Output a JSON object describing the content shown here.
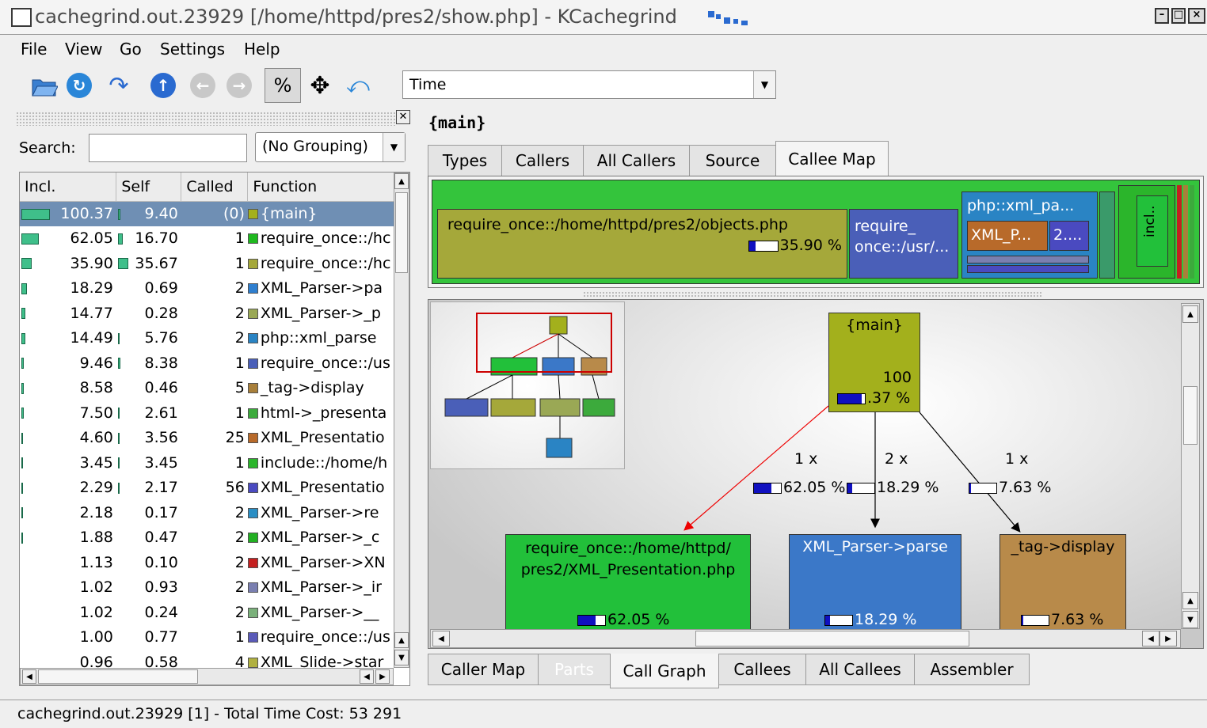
{
  "window": {
    "title": "cachegrind.out.23929 [/home/httpd/pres2/show.php] - KCachegrind"
  },
  "menu": [
    "File",
    "View",
    "Go",
    "Settings",
    "Help"
  ],
  "toolbar": {
    "percent_label": "%",
    "event_type": "Time"
  },
  "left": {
    "search_label": "Search:",
    "search_value": "",
    "grouping": "(No Grouping)",
    "columns": [
      "Incl.",
      "Self",
      "Called",
      "Function"
    ],
    "rows": [
      {
        "incl": "100.37",
        "self": "9.40",
        "called": "(0)",
        "func": "{main}",
        "color": "#a3b01c"
      },
      {
        "incl": "62.05",
        "self": "16.70",
        "called": "1",
        "func": "require_once::/hc",
        "color": "#1fb91f"
      },
      {
        "incl": "35.90",
        "self": "35.67",
        "called": "1",
        "func": "require_once::/hc",
        "color": "#a5a83a"
      },
      {
        "incl": "18.29",
        "self": "0.69",
        "called": "2",
        "func": "XML_Parser->pa",
        "color": "#2f7fcf"
      },
      {
        "incl": "14.77",
        "self": "0.28",
        "called": "2",
        "func": "XML_Parser->_p",
        "color": "#9aa855"
      },
      {
        "incl": "14.49",
        "self": "5.76",
        "called": "2",
        "func": "php::xml_parse",
        "color": "#2a84c4"
      },
      {
        "incl": "9.46",
        "self": "8.38",
        "called": "1",
        "func": "require_once::/us",
        "color": "#4a5fb8"
      },
      {
        "incl": "8.58",
        "self": "0.46",
        "called": "5",
        "func": "_tag->display",
        "color": "#a87f3a"
      },
      {
        "incl": "7.50",
        "self": "2.61",
        "called": "1",
        "func": "html->_presenta",
        "color": "#3caa3c"
      },
      {
        "incl": "4.60",
        "self": "3.56",
        "called": "25",
        "func": "XML_Presentatio",
        "color": "#b86a2a"
      },
      {
        "incl": "3.45",
        "self": "3.45",
        "called": "1",
        "func": "include::/home/h",
        "color": "#2bb52b"
      },
      {
        "incl": "2.29",
        "self": "2.17",
        "called": "56",
        "func": "XML_Presentatio",
        "color": "#4a4ac0"
      },
      {
        "incl": "2.18",
        "self": "0.17",
        "called": "2",
        "func": "XML_Parser->re",
        "color": "#2a8ec4"
      },
      {
        "incl": "1.88",
        "self": "0.47",
        "called": "2",
        "func": "XML_Parser->_c",
        "color": "#22b022"
      },
      {
        "incl": "1.13",
        "self": "0.10",
        "called": "2",
        "func": "XML_Parser->XN",
        "color": "#c42020"
      },
      {
        "incl": "1.02",
        "self": "0.93",
        "called": "2",
        "func": "XML_Parser->_ir",
        "color": "#7a7fb0"
      },
      {
        "incl": "1.02",
        "self": "0.24",
        "called": "2",
        "func": "XML_Parser->__",
        "color": "#7ab07a"
      },
      {
        "incl": "1.00",
        "self": "0.77",
        "called": "1",
        "func": "require_once::/us",
        "color": "#5a5ab8"
      },
      {
        "incl": "0.96",
        "self": "0.58",
        "called": "4",
        "func": "XML_Slide->star",
        "color": "#b0b040"
      }
    ]
  },
  "right": {
    "function_title": "{main}",
    "top_tabs": [
      "Types",
      "Callers",
      "All Callers",
      "Source",
      "Callee Map"
    ],
    "callee_map": {
      "block1_label": "require_once::/home/httpd/pres2/objects.php",
      "block1_pct": "35.90 %",
      "block2_label": "require_ once::/usr/...",
      "block3_label": "php::xml_pa...",
      "block4_label": "XML_P...",
      "block5_label": "2....",
      "block6_label": "incl.."
    },
    "graph": {
      "main_label": "{main}",
      "main_value": "100",
      "main_pct": ".37 %",
      "edge1_count": "1 x",
      "edge1_pct": "62.05 %",
      "edge2_count": "2 x",
      "edge2_pct": "18.29 %",
      "edge3_count": "1 x",
      "edge3_pct": "7.63 %",
      "node1_label": "require_once::/home/httpd/ pres2/XML_Presentation.php",
      "node1_pct": "62.05 %",
      "node2_label": "XML_Parser->parse",
      "node2_pct": "18.29 %",
      "node3_label": "_tag->display",
      "node3_pct": "7.63 %"
    },
    "bottom_tabs": [
      "Caller Map",
      "Parts",
      "Call Graph",
      "Callees",
      "All Callees",
      "Assembler"
    ]
  },
  "status": "cachegrind.out.23929 [1] - Total Time Cost:  53 291",
  "colors": {
    "selection": "#6f8fb4",
    "main_node": "#a3b01c",
    "green_node": "#22c03a",
    "blue_node": "#3b78c8",
    "brown_node": "#b88a4a"
  }
}
